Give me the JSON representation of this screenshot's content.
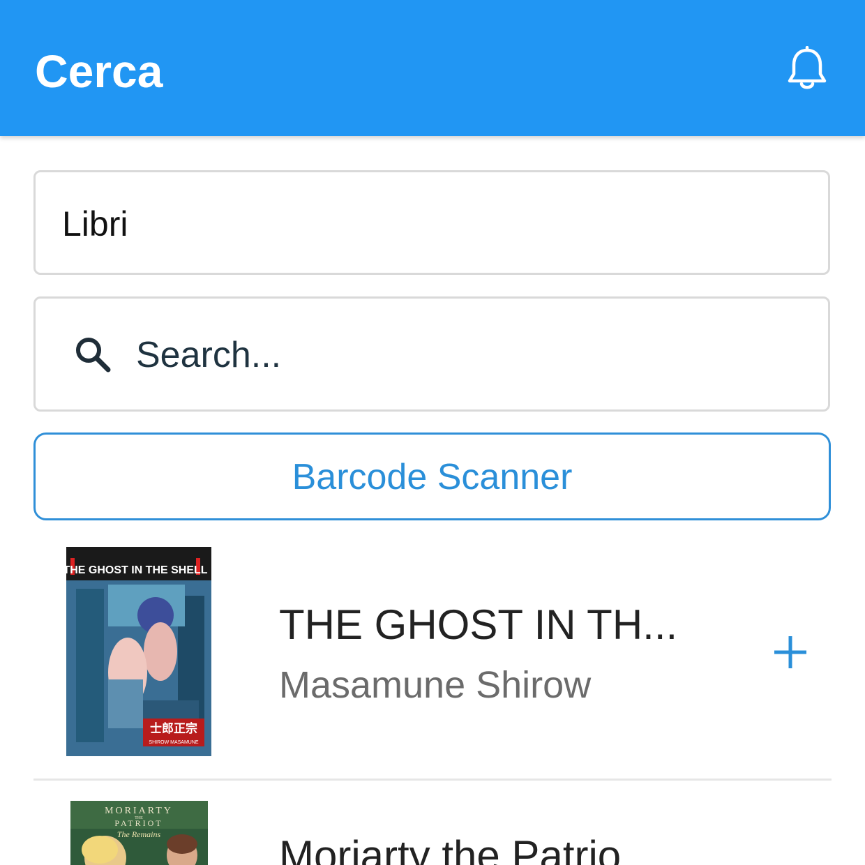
{
  "appbar": {
    "title": "Cerca",
    "notification_icon": "bell-icon"
  },
  "category_select": {
    "value": "Libri"
  },
  "search": {
    "placeholder": "Search...",
    "icon": "search-icon"
  },
  "barcode_button": {
    "label": "Barcode Scanner"
  },
  "results": [
    {
      "title": "THE GHOST IN TH...",
      "author": "Masamune Shirow",
      "add_icon": "plus-icon",
      "cover_text": {
        "title": "THE GHOST IN THE SHELL",
        "kanji": "士郎正宗",
        "romaji": "SHIROW MASAMUNE"
      }
    },
    {
      "title": "Moriarty the Patrio",
      "author": "",
      "cover_text": {
        "title": "MORIARTY",
        "the": "THE",
        "patriot": "PATRIOT",
        "script": "The Remains"
      }
    }
  ],
  "colors": {
    "primary": "#2196F3",
    "accent": "#2a8fd9",
    "divider": "#e6e6e6"
  }
}
